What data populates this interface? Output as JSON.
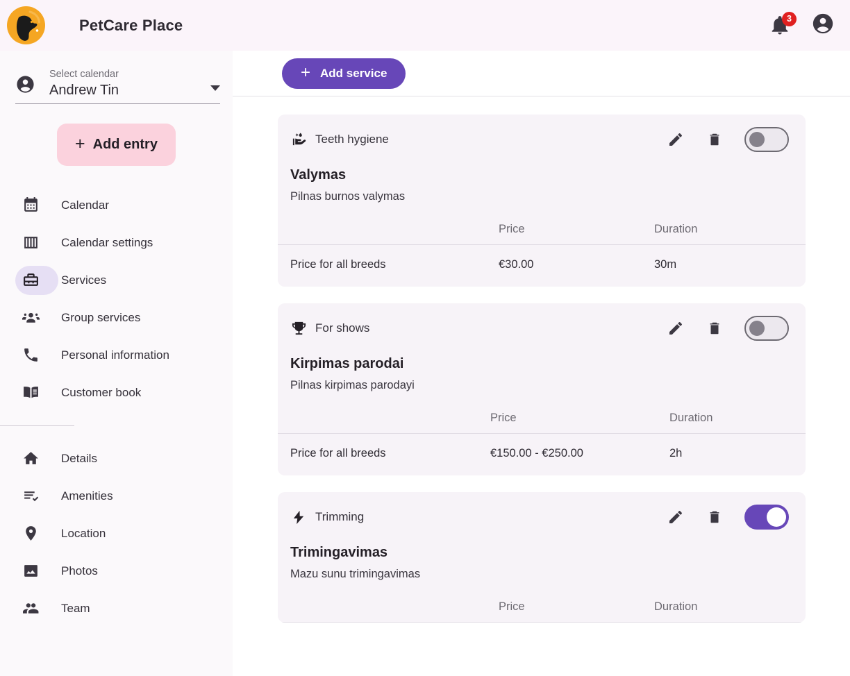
{
  "app": {
    "brand": "PetCare Place",
    "logo_icon": "dog-head-logo",
    "logo_bg": "#f5a623"
  },
  "topbar": {
    "notifications": {
      "icon": "bell-icon",
      "count": "3",
      "badge_color": "#e02020"
    },
    "account": {
      "icon": "account-circle-icon"
    }
  },
  "sidebar": {
    "calendar_select": {
      "icon": "person-icon",
      "label": "Select calendar",
      "value": "Andrew Tin",
      "caret_icon": "chevron-down-icon"
    },
    "add_entry": {
      "label": "Add entry",
      "icon": "plus-icon",
      "bg": "#fbd2dd"
    },
    "items": [
      {
        "label": "Calendar",
        "icon": "calendar-icon",
        "active": false
      },
      {
        "label": "Calendar settings",
        "icon": "calendar-settings-icon",
        "active": false
      },
      {
        "label": "Services",
        "icon": "toolbox-icon",
        "active": true
      },
      {
        "label": "Group services",
        "icon": "group-icon",
        "active": false
      },
      {
        "label": "Personal information",
        "icon": "phone-icon",
        "active": false
      },
      {
        "label": "Customer book",
        "icon": "book-icon",
        "active": false
      }
    ],
    "items_secondary": [
      {
        "label": "Details",
        "icon": "home-icon"
      },
      {
        "label": "Amenities",
        "icon": "checklist-icon"
      },
      {
        "label": "Location",
        "icon": "location-pin-icon"
      },
      {
        "label": "Photos",
        "icon": "image-icon"
      },
      {
        "label": "Team",
        "icon": "people-icon"
      }
    ],
    "active_pill_color": "#e6dff4"
  },
  "main": {
    "toolbar": {
      "add_service_label": "Add service",
      "add_service_icon": "plus-icon",
      "accent": "#6747b8"
    },
    "table_headers": {
      "price": "Price",
      "duration": "Duration"
    },
    "services": [
      {
        "category": "Teeth hygiene",
        "category_icon": "hand-sanitizer-icon",
        "name": "Valymas",
        "description": "Pilnas burnos valymas",
        "enabled": false,
        "edit_icon": "pencil-icon",
        "delete_icon": "trash-icon",
        "rows": [
          {
            "label": "Price for all breeds",
            "price": "€30.00",
            "duration": "30m"
          }
        ]
      },
      {
        "category": "For shows",
        "category_icon": "trophy-icon",
        "name": "Kirpimas parodai",
        "description": "Pilnas kirpimas parodayi",
        "enabled": false,
        "edit_icon": "pencil-icon",
        "delete_icon": "trash-icon",
        "rows": [
          {
            "label": "Price for all breeds",
            "price": "€150.00 - €250.00",
            "duration": "2h"
          }
        ]
      },
      {
        "category": "Trimming",
        "category_icon": "lightning-bolt-icon",
        "name": "Trimingavimas",
        "description": "Mazu sunu trimingavimas",
        "enabled": true,
        "edit_icon": "pencil-icon",
        "delete_icon": "trash-icon",
        "rows": []
      }
    ]
  }
}
